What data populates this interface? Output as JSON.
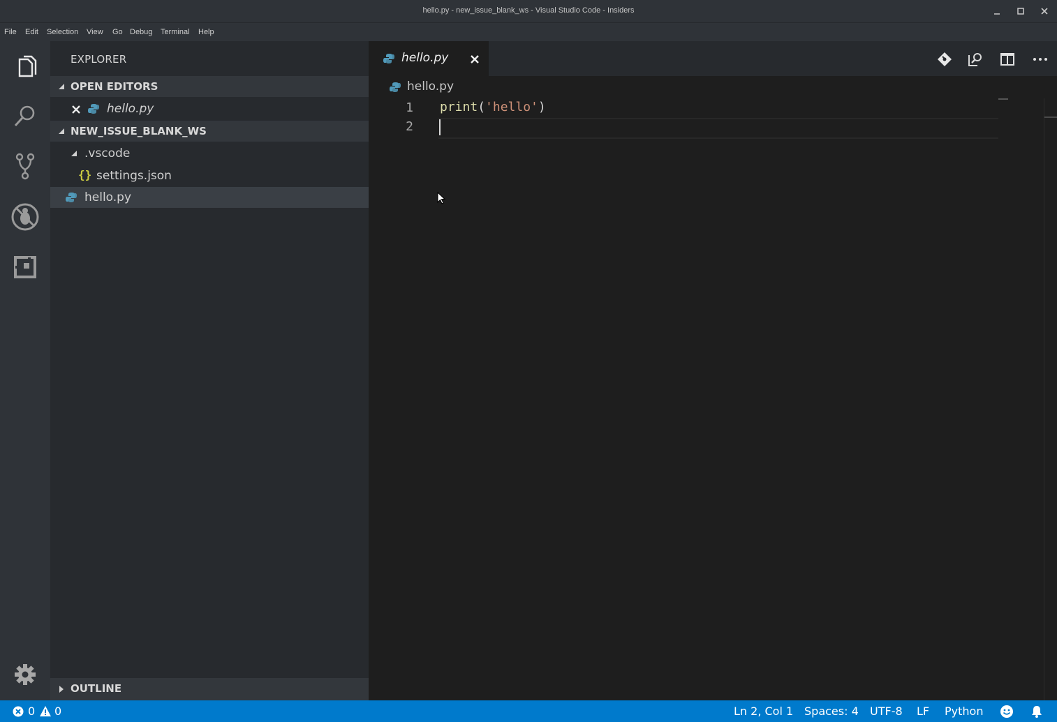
{
  "window": {
    "title": "hello.py - new_issue_blank_ws - Visual Studio Code - Insiders"
  },
  "menu": [
    "File",
    "Edit",
    "Selection",
    "View",
    "Go",
    "Debug",
    "Terminal",
    "Help"
  ],
  "sidebar": {
    "title": "EXPLORER",
    "open_editors": {
      "label": "OPEN EDITORS",
      "items": [
        {
          "name": "hello.py"
        }
      ]
    },
    "workspace": {
      "label": "NEW_ISSUE_BLANK_WS",
      "folder": ".vscode",
      "folder_children": [
        "settings.json"
      ],
      "files": [
        "hello.py"
      ]
    },
    "outline_label": "OUTLINE"
  },
  "editor": {
    "tab": {
      "label": "hello.py"
    },
    "breadcrumb": "hello.py",
    "line_numbers": [
      "1",
      "2"
    ],
    "lines": [
      {
        "func": "print",
        "open": "(",
        "str": "'hello'",
        "close": ")"
      },
      {
        "text": ""
      }
    ]
  },
  "status": {
    "errors": "0",
    "warnings": "0",
    "position": "Ln 2, Col 1",
    "spaces": "Spaces: 4",
    "encoding": "UTF-8",
    "eol": "LF",
    "language": "Python"
  },
  "colors": {
    "accent": "#007acc",
    "string": "#ce9178",
    "func": "#dcdcaa",
    "python_icon": "#519aba",
    "json_icon": "#cbcb41"
  }
}
